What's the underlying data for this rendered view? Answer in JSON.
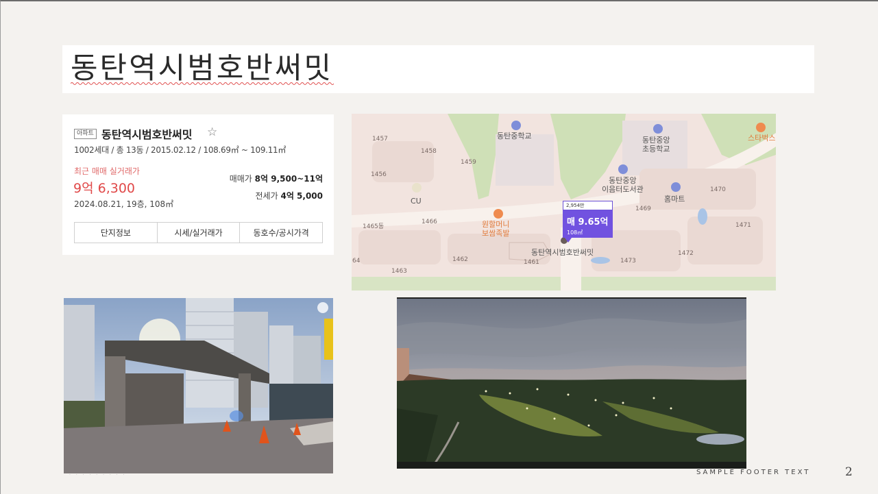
{
  "slide": {
    "title": "동탄역시범호반써밋",
    "footer": "SAMPLE FOOTER TEXT",
    "page_number": "2"
  },
  "card": {
    "badge": "아파트",
    "name": "동탄역시범호반써밋",
    "favorite_icon": "star-outline-icon",
    "meta": "1002세대 / 총 13동 / 2015.02.12 / 108.69㎡ ~ 109.11㎡",
    "recent_label": "최근 매매 실거래가",
    "recent_price": "9억 6,300",
    "recent_date": "2024.08.21, 19층, 108㎡",
    "sale_label": "매매가",
    "sale_value": "8억 9,500~11억",
    "lease_label": "전세가",
    "lease_value": "4억 5,000",
    "tabs": [
      "단지정보",
      "시세/실거래가",
      "동호수/공시가격"
    ],
    "accent_color": "#e04848"
  },
  "map": {
    "block_numbers": [
      "1457",
      "1458",
      "1459",
      "1456",
      "1465동",
      "1466",
      "1462",
      "1463",
      "1461",
      "1469",
      "1470",
      "1471",
      "1472",
      "1473",
      "64"
    ],
    "pois": {
      "school1": "동탄중학교",
      "school2_line1": "동탄중앙",
      "school2_line2": "초등학교",
      "library_line1": "동탄중앙",
      "library_line2": "이음터도서관",
      "mart": "홈마트",
      "cafe": "스타벅스",
      "cu": "CU",
      "restaurant_line1": "원할머니",
      "restaurant_line2": "보쌈족발",
      "apartment": "동탄역시범호반써밋"
    },
    "pin": {
      "top": "2,954만",
      "price": "매 9.65억",
      "area": "108㎡",
      "color": "#7152e0"
    }
  }
}
